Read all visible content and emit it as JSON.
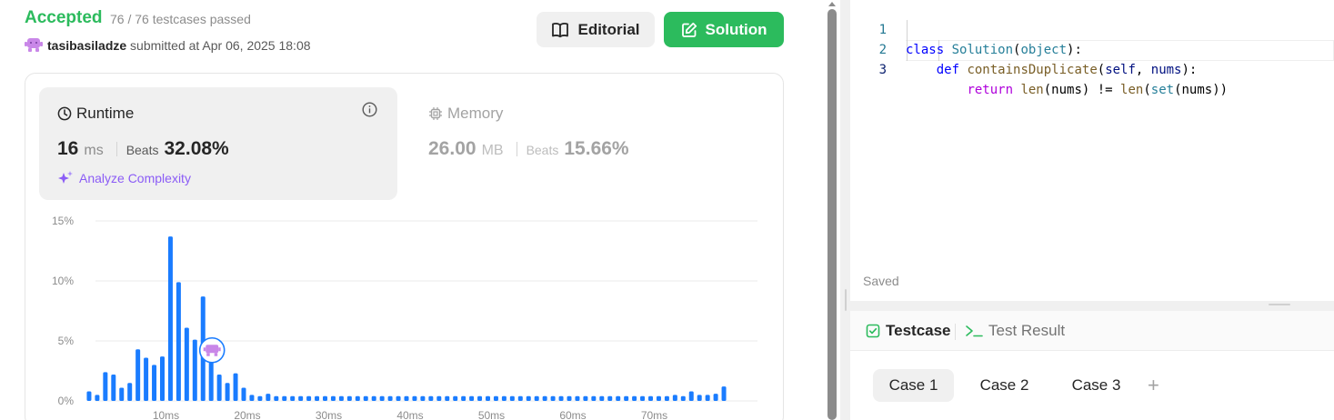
{
  "submission": {
    "status": "Accepted",
    "testcases": "76 / 76 testcases passed",
    "username": "tasibasiladze",
    "submitted_text": "submitted at Apr 06, 2025 18:08"
  },
  "buttons": {
    "editorial": "Editorial",
    "solution": "Solution"
  },
  "runtime": {
    "title": "Runtime",
    "value": "16",
    "unit": "ms",
    "beats_label": "Beats",
    "beats_value": "32.08%",
    "analyze": "Analyze Complexity"
  },
  "memory": {
    "title": "Memory",
    "value": "26.00",
    "unit": "MB",
    "beats_label": "Beats",
    "beats_value": "15.66%"
  },
  "chart_data": {
    "type": "bar",
    "y_ticks": [
      "15%",
      "10%",
      "5%",
      "0%"
    ],
    "x_ticks": [
      "10ms",
      "20ms",
      "30ms",
      "40ms",
      "50ms",
      "60ms",
      "70ms"
    ],
    "ylim": [
      0,
      15
    ],
    "xlim": [
      0,
      80
    ],
    "grid": true,
    "bar_color": "#1a7cff",
    "marker_x": 16,
    "marker_y": 4.3,
    "x": [
      1,
      2,
      3,
      4,
      5,
      6,
      7,
      8,
      9,
      10,
      11,
      12,
      13,
      14,
      15,
      16,
      17,
      18,
      19,
      20,
      21,
      22,
      23,
      24,
      25,
      26,
      27,
      28,
      29,
      30,
      31,
      32,
      33,
      34,
      35,
      36,
      37,
      38,
      39,
      40,
      41,
      42,
      43,
      44,
      45,
      46,
      47,
      48,
      49,
      50,
      51,
      52,
      53,
      54,
      55,
      56,
      57,
      58,
      59,
      60,
      61,
      62,
      63,
      64,
      65,
      66,
      67,
      68,
      69,
      70,
      71,
      72,
      73,
      74,
      75,
      76,
      77,
      78,
      79
    ],
    "values": [
      0.8,
      0.5,
      2.4,
      2.2,
      1.1,
      1.5,
      4.3,
      3.6,
      3.0,
      3.7,
      13.7,
      9.9,
      6.1,
      5.1,
      8.7,
      3.9,
      2.2,
      1.5,
      2.3,
      1.1,
      0.5,
      0.4,
      0.6,
      0.4,
      0.4,
      0.4,
      0.4,
      0.4,
      0.4,
      0.4,
      0.4,
      0.4,
      0.4,
      0.4,
      0.4,
      0.4,
      0.4,
      0.4,
      0.4,
      0.4,
      0.4,
      0.4,
      0.4,
      0.4,
      0.4,
      0.4,
      0.4,
      0.4,
      0.4,
      0.4,
      0.4,
      0.4,
      0.4,
      0.4,
      0.4,
      0.4,
      0.4,
      0.4,
      0.4,
      0.4,
      0.4,
      0.4,
      0.4,
      0.4,
      0.4,
      0.4,
      0.4,
      0.4,
      0.4,
      0.4,
      0.4,
      0.4,
      0.5,
      0.4,
      0.8,
      0.5,
      0.5,
      0.6,
      1.2
    ]
  },
  "editor": {
    "line_numbers": [
      "1",
      "2",
      "3"
    ],
    "line1": {
      "kw": "class",
      "name": "Solution",
      "open": "(",
      "base": "object",
      "close": "):"
    },
    "line2": {
      "kw": "def",
      "name": "containsDuplicate",
      "open": "(",
      "p1": "self",
      "comma": ", ",
      "p2": "nums",
      "close": "):"
    },
    "line3": {
      "kw": "return",
      "fn1": "len",
      "a1": "(nums) != ",
      "fn2": "len",
      "a2": "(",
      "fn3": "set",
      "a3": "(nums))"
    },
    "saved_label": "Saved"
  },
  "testcase_panel": {
    "tab_testcase": "Testcase",
    "tab_result": "Test Result",
    "cases": [
      "Case 1",
      "Case 2",
      "Case 3"
    ],
    "add_symbol": "+"
  }
}
